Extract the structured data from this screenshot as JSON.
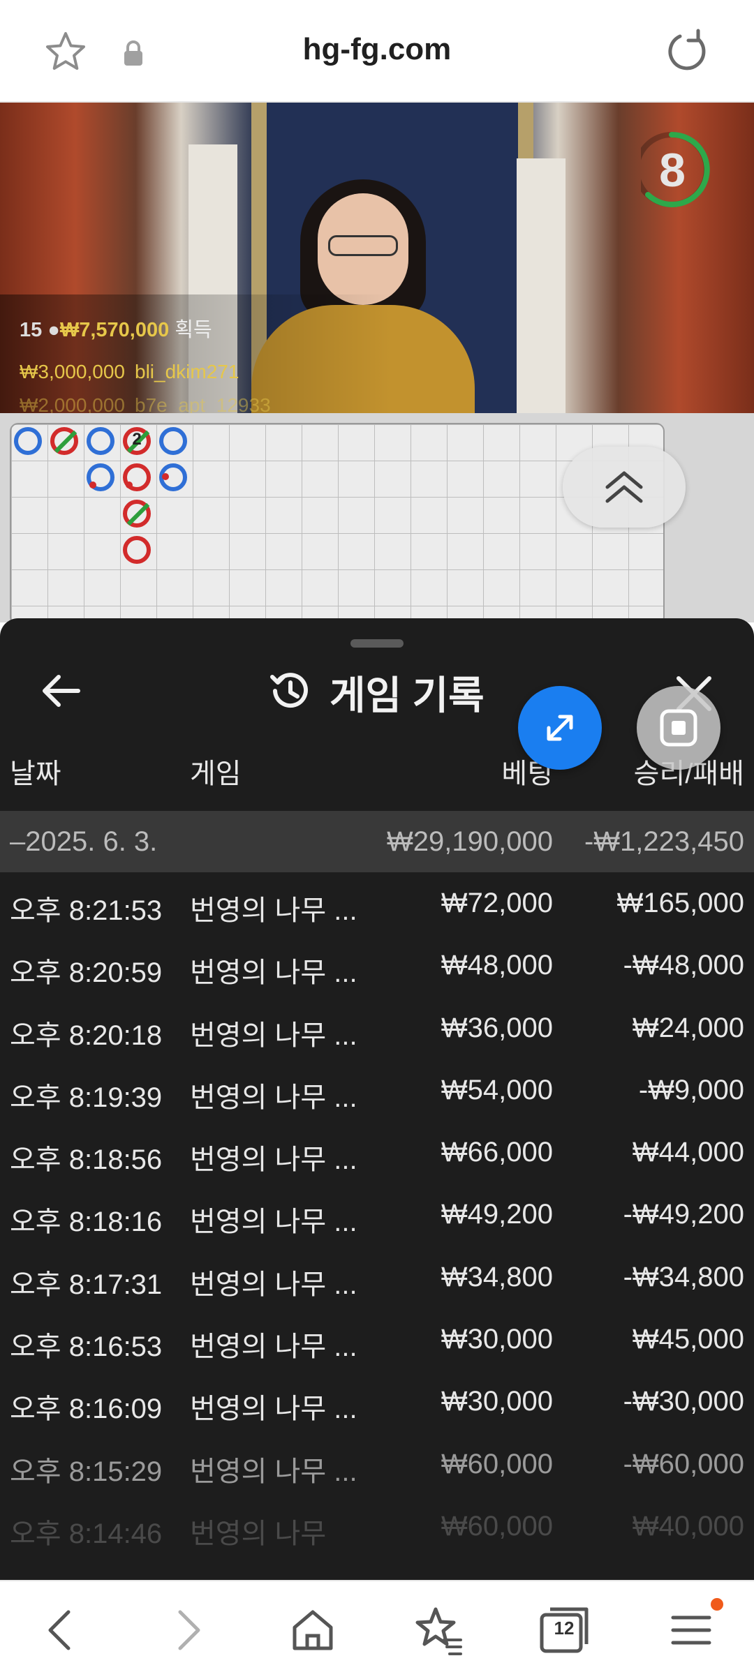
{
  "browser": {
    "url": "hg-fg.com",
    "icons": {
      "favorite": "star-outline-icon",
      "secure": "lock-icon",
      "reload": "reload-icon"
    }
  },
  "video": {
    "timer": "8",
    "win": {
      "count": "15",
      "amount": "₩7,570,000",
      "label": "획득"
    },
    "recent_bets": [
      {
        "amount": "₩3,000,000",
        "user": "bli_dkim271"
      },
      {
        "amount": "₩2,000,000",
        "user": "b7e_apt_12933"
      }
    ]
  },
  "scoreboard": {
    "count_marker": "2",
    "sidebets": [
      "P",
      "B",
      "T",
      "P"
    ]
  },
  "history": {
    "title": "게임 기록",
    "columns": {
      "date": "날짜",
      "game": "게임",
      "bet": "베팅",
      "result": "승리/패배"
    },
    "summary": {
      "date": "–2025. 6. 3.",
      "bet": "₩29,190,000",
      "result": "-₩1,223,450"
    },
    "rows": [
      {
        "time": "오후 8:21:53",
        "game": "번영의 나무 ...",
        "bet": "₩72,000",
        "result": "₩165,000"
      },
      {
        "time": "오후 8:20:59",
        "game": "번영의 나무 ...",
        "bet": "₩48,000",
        "result": "-₩48,000"
      },
      {
        "time": "오후 8:20:18",
        "game": "번영의 나무 ...",
        "bet": "₩36,000",
        "result": "₩24,000"
      },
      {
        "time": "오후 8:19:39",
        "game": "번영의 나무 ...",
        "bet": "₩54,000",
        "result": "-₩9,000"
      },
      {
        "time": "오후 8:18:56",
        "game": "번영의 나무 ...",
        "bet": "₩66,000",
        "result": "₩44,000"
      },
      {
        "time": "오후 8:18:16",
        "game": "번영의 나무 ...",
        "bet": "₩49,200",
        "result": "-₩49,200"
      },
      {
        "time": "오후 8:17:31",
        "game": "번영의 나무 ...",
        "bet": "₩34,800",
        "result": "-₩34,800"
      },
      {
        "time": "오후 8:16:53",
        "game": "번영의 나무 ...",
        "bet": "₩30,000",
        "result": "₩45,000"
      },
      {
        "time": "오후 8:16:09",
        "game": "번영의 나무 ...",
        "bet": "₩30,000",
        "result": "-₩30,000"
      },
      {
        "time": "오후 8:15:29",
        "game": "번영의 나무 ...",
        "bet": "₩60,000",
        "result": "-₩60,000"
      },
      {
        "time": "오후 8:14:46",
        "game": "번영의 나무",
        "bet": "₩60,000",
        "result": "₩40,000"
      }
    ]
  },
  "bottom_nav": {
    "tab_count": "12"
  },
  "colors": {
    "sheet_bg": "#1d1d1d",
    "summary_bg": "#393939",
    "accent_blue": "#1a7ef0",
    "timer_green": "#2ea84a",
    "gold_text": "#e6c74a",
    "notification": "#f05a1a"
  }
}
